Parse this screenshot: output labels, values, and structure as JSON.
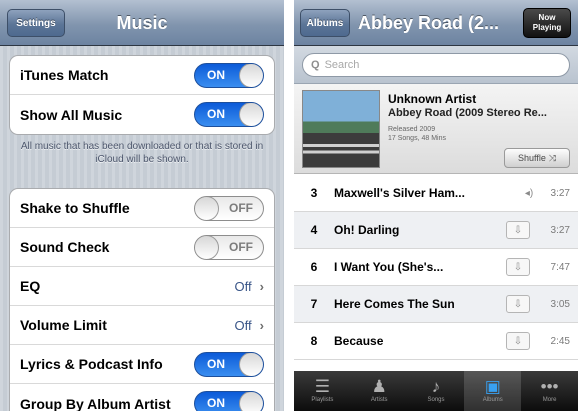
{
  "left": {
    "back_label": "Settings",
    "title": "Music",
    "group1": [
      {
        "label": "iTunes Match",
        "state": "ON"
      },
      {
        "label": "Show All Music",
        "state": "ON"
      }
    ],
    "footnote": "All music that has been downloaded or that is stored in iCloud will be shown.",
    "group2": [
      {
        "label": "Shake to Shuffle",
        "state": "OFF"
      },
      {
        "label": "Sound Check",
        "state": "OFF"
      },
      {
        "label": "EQ",
        "value": "Off"
      },
      {
        "label": "Volume Limit",
        "value": "Off"
      },
      {
        "label": "Lyrics & Podcast Info",
        "state": "ON"
      },
      {
        "label": "Group By Album Artist",
        "state": "ON"
      }
    ]
  },
  "right": {
    "back_label": "Albums",
    "title": "Abbey Road (2...",
    "now_playing_line1": "Now",
    "now_playing_line2": "Playing",
    "search_placeholder": "Search",
    "album": {
      "artist": "Unknown Artist",
      "title": "Abbey Road (2009 Stereo Re...",
      "released": "Released 2009",
      "info": "17 Songs, 48 Mins",
      "shuffle_label": "Shuffle"
    },
    "tracks": [
      {
        "num": "3",
        "name": "Maxwell's Silver Ham...",
        "duration": "3:27"
      },
      {
        "num": "4",
        "name": "Oh! Darling",
        "duration": "3:27"
      },
      {
        "num": "6",
        "name": "I Want You (She's...",
        "duration": "7:47"
      },
      {
        "num": "7",
        "name": "Here Comes The Sun",
        "duration": "3:05"
      },
      {
        "num": "8",
        "name": "Because",
        "duration": "2:45"
      }
    ],
    "tabs": [
      {
        "label": "Playlists",
        "icon": "playlists-icon",
        "selected": false
      },
      {
        "label": "Artists",
        "icon": "artists-icon",
        "selected": false
      },
      {
        "label": "Songs",
        "icon": "songs-icon",
        "selected": false
      },
      {
        "label": "Albums",
        "icon": "albums-icon",
        "selected": true
      },
      {
        "label": "More",
        "icon": "more-icon",
        "selected": false
      }
    ]
  },
  "colors": {
    "switch_on": "#2f7be8",
    "navbar": "#8195ae",
    "value_text": "#385487"
  }
}
